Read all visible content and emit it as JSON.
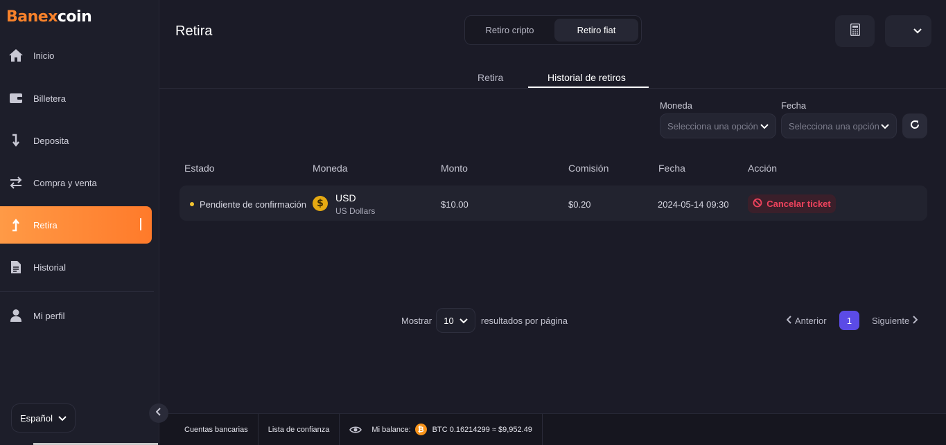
{
  "brand": {
    "name_part1": "Banex",
    "name_part2": "coin"
  },
  "sidebar": {
    "items": [
      {
        "label": "Inicio",
        "icon": "home-icon"
      },
      {
        "label": "Billetera",
        "icon": "wallet-icon"
      },
      {
        "label": "Deposita",
        "icon": "arrow-down-icon"
      },
      {
        "label": "Compra y venta",
        "icon": "swap-icon"
      },
      {
        "label": "Retira",
        "icon": "arrow-up-icon",
        "active": true
      },
      {
        "label": "Historial",
        "icon": "document-icon"
      },
      {
        "label": "Mi perfil",
        "icon": "user-icon"
      }
    ],
    "language": "Español"
  },
  "header": {
    "title": "Retira",
    "segments": [
      "Retiro cripto",
      "Retiro fiat"
    ],
    "selected_segment": "Retiro fiat"
  },
  "tabs": {
    "items": [
      "Retira",
      "Historial de retiros"
    ],
    "active": "Historial de retiros"
  },
  "filters": {
    "currency_label": "Moneda",
    "currency_placeholder": "Selecciona una opción",
    "date_label": "Fecha",
    "date_placeholder": "Selecciona una opción"
  },
  "table": {
    "headers": [
      "Estado",
      "Moneda",
      "Monto",
      "Comisión",
      "Fecha",
      "Acción"
    ],
    "rows": [
      {
        "status": "Pendiente de confirmación",
        "currency_code": "USD",
        "currency_name": "US Dollars",
        "amount": "$10.00",
        "fee": "$0.20",
        "date": "2024-05-14 09:30",
        "action": "Cancelar ticket"
      }
    ]
  },
  "pagination": {
    "show_label": "Mostrar",
    "per_page": "10",
    "results_label": "resultados por página",
    "prev": "Anterior",
    "page": "1",
    "next": "Siguiente"
  },
  "footer": {
    "bank_accounts": "Cuentas bancarias",
    "trust_list": "Lista de confianza",
    "balance_label": "Mi balance:",
    "balance_value": "BTC 0.16214299 ≈ $9,952.49"
  },
  "colors": {
    "accent": "#ff8a35",
    "danger": "#f0435d",
    "primary": "#5b4be6",
    "bitcoin": "#f7931a"
  }
}
